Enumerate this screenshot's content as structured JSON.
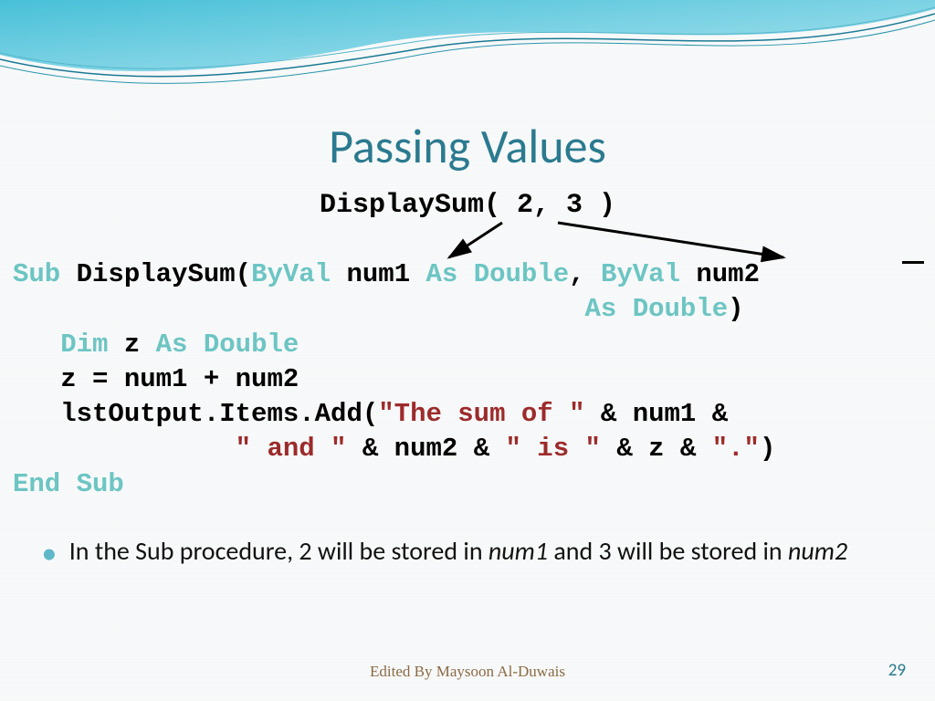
{
  "title": "Passing Values",
  "call_line": "DisplaySum( 2, 3 )",
  "code": {
    "l1_sub": "Sub",
    "l1_name_open": " DisplaySum(",
    "l1_byval1": "ByVal",
    "l1_num1": " num1 ",
    "l1_asd1": "As Double",
    "l1_comma": ", ",
    "l1_byval2": "ByVal",
    "l1_num2": " num2",
    "l2_asd2": "As Double",
    "l2_close": ")",
    "l3_dim": "Dim",
    "l3_z": " z ",
    "l3_asd": "As Double",
    "l4": "   z = num1 + num2",
    "l5a": "   lstOutput.Items.Add(",
    "l5s1": "\"The sum of \"",
    "l5b": " & num1 &",
    "l6s1": "\" and \"",
    "l6a": " & num2 & ",
    "l6s2": "\" is \"",
    "l6b": " & z & ",
    "l6s3": "\".\"",
    "l6c": ")",
    "l7": "End Sub"
  },
  "bullet_prefix": "In the Sub procedure, 2 will be stored in ",
  "bullet_num1": "num1",
  "bullet_mid": " and 3 will be stored in ",
  "bullet_num2": "num2",
  "footer": "Edited By Maysoon Al-Duwais",
  "page_number": "29"
}
